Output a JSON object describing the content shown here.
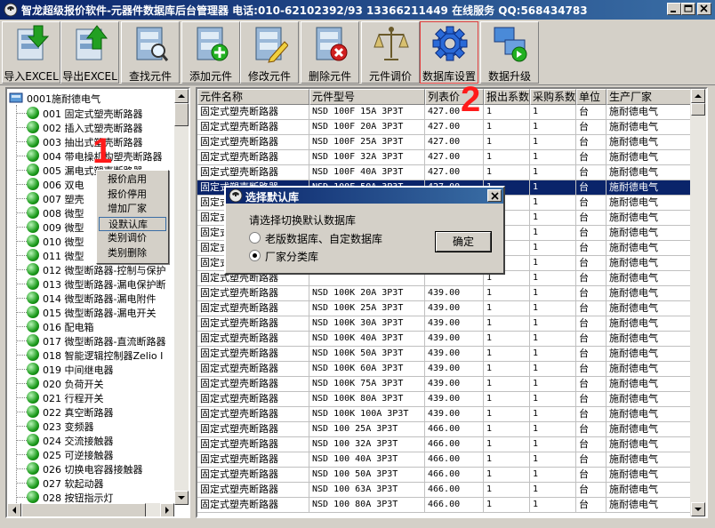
{
  "window": {
    "title": "智龙超级报价软件-元器件数据库后台管理器  电话:010-62102392/93 13366211449 在线服务 QQ:568434783",
    "icon": "phone-icon",
    "controls": [
      "minimize-icon",
      "maximize-icon",
      "close-icon"
    ]
  },
  "toolbar": {
    "buttons": [
      {
        "label": "导入EXCEL",
        "icon": "import-excel-icon"
      },
      {
        "label": "导出EXCEL",
        "icon": "export-excel-icon"
      },
      {
        "label": "查找元件",
        "icon": "find-component-icon"
      },
      {
        "label": "添加元件",
        "icon": "add-component-icon"
      },
      {
        "label": "修改元件",
        "icon": "edit-component-icon"
      },
      {
        "label": "删除元件",
        "icon": "delete-component-icon"
      },
      {
        "label": "元件调价",
        "icon": "scale-icon"
      },
      {
        "label": "数据库设置",
        "icon": "gear-icon"
      },
      {
        "label": "数据升级",
        "icon": "upgrade-icon"
      }
    ]
  },
  "tree": {
    "root": "0001施耐德电气",
    "items": [
      "001  固定式塑壳断路器",
      "002  插入式塑壳断路器",
      "003  抽出式塑壳断路器",
      "004  带电操机构塑壳断路器",
      "005  漏电式塑壳断路器",
      "006  双电",
      "007  塑壳",
      "008  微型",
      "009  微型",
      "010  微型",
      "011  微型",
      "012  微型断路器-控制与保护",
      "013  微型断路器-漏电保护断",
      "014  微型断路器-漏电附件",
      "015  微型断路器-漏电开关",
      "016  配电箱",
      "017  微型断路器-直流断路器",
      "018  智能逻辑控制器Zelio I",
      "019  中间继电器",
      "020  负荷开关",
      "021  行程开关",
      "022  真空断路器",
      "023  变频器",
      "024  交流接触器",
      "025  可逆接触器",
      "026  切换电容器接触器",
      "027  软起动器",
      "028  按钮指示灯"
    ]
  },
  "grid": {
    "columns": [
      "元件名称",
      "元件型号",
      "列表价",
      "报出系数",
      "采购系数",
      "单位",
      "生产厂家"
    ],
    "rows": [
      [
        "固定式塑壳断路器",
        "NSD 100F 15A 3P3T",
        "427.00",
        "1",
        "1",
        "台",
        "施耐德电气"
      ],
      [
        "固定式塑壳断路器",
        "NSD 100F 20A 3P3T",
        "427.00",
        "1",
        "1",
        "台",
        "施耐德电气"
      ],
      [
        "固定式塑壳断路器",
        "NSD 100F 25A 3P3T",
        "427.00",
        "1",
        "1",
        "台",
        "施耐德电气"
      ],
      [
        "固定式塑壳断路器",
        "NSD 100F 32A 3P3T",
        "427.00",
        "1",
        "1",
        "台",
        "施耐德电气"
      ],
      [
        "固定式塑壳断路器",
        "NSD 100F 40A 3P3T",
        "427.00",
        "1",
        "1",
        "台",
        "施耐德电气"
      ],
      [
        "固定式塑壳断路器",
        "NSD 100F 50A 3P3T",
        "427.00",
        "1",
        "1",
        "台",
        "施耐德电气"
      ],
      [
        "固定式塑壳断路器",
        "",
        "",
        "1",
        "1",
        "台",
        "施耐德电气"
      ],
      [
        "固定式塑壳断路器",
        "",
        "",
        "1",
        "1",
        "台",
        "施耐德电气"
      ],
      [
        "固定式塑壳断路器",
        "",
        "",
        "1",
        "1",
        "台",
        "施耐德电气"
      ],
      [
        "固定式塑壳断路器",
        "",
        "",
        "1",
        "1",
        "台",
        "施耐德电气"
      ],
      [
        "固定式塑壳断路器",
        "",
        "",
        "1",
        "1",
        "台",
        "施耐德电气"
      ],
      [
        "固定式塑壳断路器",
        "",
        "",
        "1",
        "1",
        "台",
        "施耐德电气"
      ],
      [
        "固定式塑壳断路器",
        "NSD 100K 20A 3P3T",
        "439.00",
        "1",
        "1",
        "台",
        "施耐德电气"
      ],
      [
        "固定式塑壳断路器",
        "NSD 100K 25A 3P3T",
        "439.00",
        "1",
        "1",
        "台",
        "施耐德电气"
      ],
      [
        "固定式塑壳断路器",
        "NSD 100K 30A 3P3T",
        "439.00",
        "1",
        "1",
        "台",
        "施耐德电气"
      ],
      [
        "固定式塑壳断路器",
        "NSD 100K 40A 3P3T",
        "439.00",
        "1",
        "1",
        "台",
        "施耐德电气"
      ],
      [
        "固定式塑壳断路器",
        "NSD 100K 50A 3P3T",
        "439.00",
        "1",
        "1",
        "台",
        "施耐德电气"
      ],
      [
        "固定式塑壳断路器",
        "NSD 100K 60A 3P3T",
        "439.00",
        "1",
        "1",
        "台",
        "施耐德电气"
      ],
      [
        "固定式塑壳断路器",
        "NSD 100K 75A 3P3T",
        "439.00",
        "1",
        "1",
        "台",
        "施耐德电气"
      ],
      [
        "固定式塑壳断路器",
        "NSD 100K 80A 3P3T",
        "439.00",
        "1",
        "1",
        "台",
        "施耐德电气"
      ],
      [
        "固定式塑壳断路器",
        "NSD 100K 100A 3P3T",
        "439.00",
        "1",
        "1",
        "台",
        "施耐德电气"
      ],
      [
        "固定式塑壳断路器",
        "NSD 100 25A 3P3T",
        "466.00",
        "1",
        "1",
        "台",
        "施耐德电气"
      ],
      [
        "固定式塑壳断路器",
        "NSD 100 32A 3P3T",
        "466.00",
        "1",
        "1",
        "台",
        "施耐德电气"
      ],
      [
        "固定式塑壳断路器",
        "NSD 100 40A 3P3T",
        "466.00",
        "1",
        "1",
        "台",
        "施耐德电气"
      ],
      [
        "固定式塑壳断路器",
        "NSD 100 50A 3P3T",
        "466.00",
        "1",
        "1",
        "台",
        "施耐德电气"
      ],
      [
        "固定式塑壳断路器",
        "NSD 100 63A 3P3T",
        "466.00",
        "1",
        "1",
        "台",
        "施耐德电气"
      ],
      [
        "固定式塑壳断路器",
        "NSD 100 80A 3P3T",
        "466.00",
        "1",
        "1",
        "台",
        "施耐德电气"
      ]
    ],
    "selected_row": 5
  },
  "context_menu": {
    "items": [
      "报价启用",
      "报价停用",
      "增加厂家",
      "设默认库",
      "类别调价",
      "类别删除"
    ],
    "focused": 3
  },
  "dialog": {
    "title": "选择默认库",
    "prompt": "请选择切换默认数据库",
    "options": [
      {
        "label": "老版数据库、自定数据库",
        "checked": false
      },
      {
        "label": "厂家分类库",
        "checked": true
      }
    ],
    "ok_label": "确定"
  },
  "annotations": {
    "marker1": "1",
    "marker2": "2",
    "color": "#ff1a1a"
  }
}
